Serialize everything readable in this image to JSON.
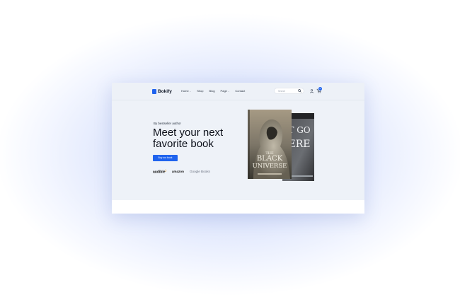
{
  "brand": {
    "name": "Bokify"
  },
  "nav": [
    {
      "label": "Home",
      "has_dropdown": true
    },
    {
      "label": "Shop",
      "has_dropdown": false
    },
    {
      "label": "Blog",
      "has_dropdown": false
    },
    {
      "label": "Page",
      "has_dropdown": true
    },
    {
      "label": "Contact",
      "has_dropdown": false
    }
  ],
  "search": {
    "placeholder": "Search"
  },
  "cart": {
    "count": "0"
  },
  "hero": {
    "kicker": "By bestseller author",
    "headline_line1": "Meet your next",
    "headline_line2": "favorite book",
    "cta_label": "Buy our book"
  },
  "partners": {
    "audible": "audible",
    "amazon": "amazon",
    "google": "Google Books"
  },
  "books": {
    "front": {
      "title_line1": "THE",
      "title_line2": "BLACK",
      "title_line3": "UNIVERSE"
    },
    "back": {
      "title_line1": "T GO",
      "title_line2": "ERE"
    }
  },
  "colors": {
    "accent": "#1f63ee",
    "background": "#eef2f8",
    "text": "#0b0f19"
  },
  "icons": {
    "search": "search-icon",
    "user": "user-icon",
    "cart": "cart-icon",
    "caret": "chevron-down-icon"
  }
}
